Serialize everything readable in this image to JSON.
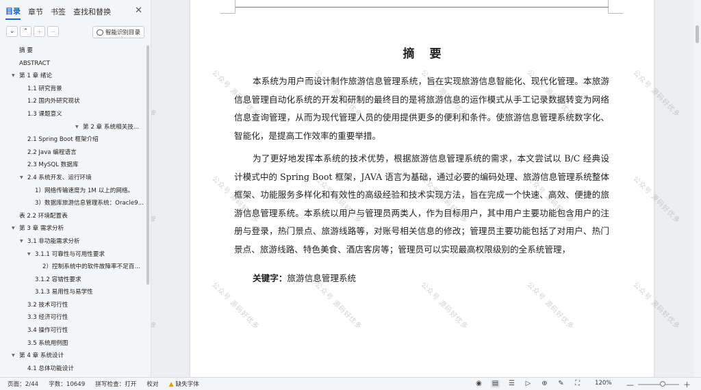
{
  "pane": {
    "tabs": [
      "目录",
      "章节",
      "书签",
      "查找和替换"
    ],
    "active_tab": 0,
    "smart_toc_label": "智能识别目录",
    "toc": [
      {
        "text": "摘    要",
        "indent": 28,
        "arrow": false
      },
      {
        "text": "ABSTRACT",
        "indent": 28,
        "arrow": false
      },
      {
        "text": "第 1 章   绪论",
        "indent": 28,
        "arrow": true
      },
      {
        "text": "1.1   研究背景",
        "indent": 40,
        "arrow": false
      },
      {
        "text": "1.2   国内外研究现状",
        "indent": 40,
        "arrow": false
      },
      {
        "text": "1.3   课题意义",
        "indent": 40,
        "arrow": false
      },
      {
        "text": "第 2 章   系统相关技...",
        "indent": 121,
        "arrow": true
      },
      {
        "text": "2.1 Spring Boot 框架介绍",
        "indent": 40,
        "arrow": false
      },
      {
        "text": "2.2   Java 编程语言",
        "indent": 40,
        "arrow": false
      },
      {
        "text": "2.3 MySQL 数据库",
        "indent": 40,
        "arrow": false
      },
      {
        "text": "2.4   系统开发、运行环境",
        "indent": 40,
        "arrow": true
      },
      {
        "text": "1）网络传输速度为 1M 以上的网络。",
        "indent": 51,
        "arrow": false
      },
      {
        "text": "3）数据库旅游信息管理系统：Oracle9...",
        "indent": 51,
        "arrow": false
      },
      {
        "text": "表 2.2   环境配置表",
        "indent": 28,
        "arrow": false
      },
      {
        "text": "第 3 章   需求分析",
        "indent": 28,
        "arrow": true
      },
      {
        "text": "3.1   非功能需求分析",
        "indent": 40,
        "arrow": true
      },
      {
        "text": "3.1.1   可靠性与可用性要求",
        "indent": 51,
        "arrow": true
      },
      {
        "text": "2）控制系统中的软件故障率不足百...",
        "indent": 62,
        "arrow": false
      },
      {
        "text": "3.1.2   容错性要求",
        "indent": 51,
        "arrow": false
      },
      {
        "text": "3.1.3   易用性与易学性",
        "indent": 51,
        "arrow": false
      },
      {
        "text": "3.2   技术可行性",
        "indent": 40,
        "arrow": false
      },
      {
        "text": "3.3   经济可行性",
        "indent": 40,
        "arrow": false
      },
      {
        "text": "3.4   操作可行性",
        "indent": 40,
        "arrow": false
      },
      {
        "text": "3.5 系统用例图",
        "indent": 40,
        "arrow": false
      },
      {
        "text": "第 4 章   系统设计",
        "indent": 28,
        "arrow": true
      },
      {
        "text": "4.1   总体功能设计",
        "indent": 40,
        "arrow": false
      }
    ]
  },
  "document": {
    "title": "摘要",
    "paragraphs": [
      "本系统为用户而设计制作旅游信息管理系统，旨在实现旅游信息智能化、现代化管理。本旅游信息管理自动化系统的开发和研制的最终目的是将旅游信息的运作模式从手工记录数据转变为网络信息查询管理，从而为现代管理人员的使用提供更多的便利和条件。使旅游信息管理系统数字化、智能化，是提高工作效率的重要举措。",
      "为了更好地发挥本系统的技术优势，根据旅游信息管理系统的需求，本文尝试以 B/C 经典设计模式中的 Spring Boot 框架，JAVA 语言为基础，通过必要的编码处理、旅游信息管理系统整体框架、功能服务多样化和有效性的高级经验和技术实现方法，旨在完成一个快速、高效、便捷的旅游信息管理系统。本系统以用户与管理员两类人，作为目标用户，其中用户主要功能包含用户的注册与登录，热门景点、旅游线路等，对账号相关信息的修改；管理员主要功能包括了对用户、热门景点、旅游线路、特色美食、酒店客房等；管理员可以实现最高权限级别的全系统管理，"
    ],
    "keywords_label": "关键字：",
    "keywords": "旅游信息管理系统",
    "watermark": "公众号 源码好优多"
  },
  "status": {
    "page": "页面：2/44",
    "words": "字数：10649",
    "spell": "拼写检查：打开",
    "proof": "校对",
    "missing_font": "缺失字体",
    "zoom": "120%",
    "zoom_fraction": 0.6
  }
}
